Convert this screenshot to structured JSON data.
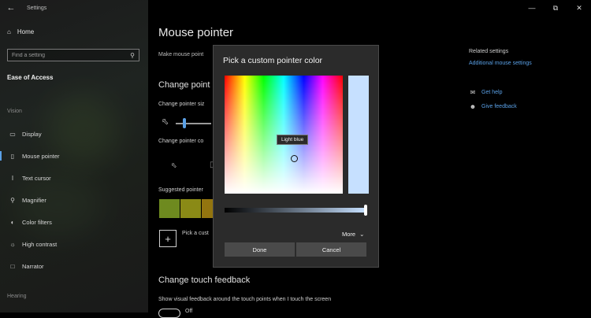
{
  "window": {
    "app_title": "Settings",
    "controls": [
      "minimize-icon",
      "restore-icon",
      "close-icon"
    ]
  },
  "sidebar": {
    "home_label": "Home",
    "search_placeholder": "Find a setting",
    "section_title": "Ease of Access",
    "group_vision": "Vision",
    "group_hearing": "Hearing",
    "items": [
      {
        "label": "Display",
        "icon": "monitor-icon"
      },
      {
        "label": "Mouse pointer",
        "icon": "mouse-icon",
        "active": true
      },
      {
        "label": "Text cursor",
        "icon": "text-cursor-icon"
      },
      {
        "label": "Magnifier",
        "icon": "magnifier-icon"
      },
      {
        "label": "Color filters",
        "icon": "color-filters-icon"
      },
      {
        "label": "High contrast",
        "icon": "high-contrast-icon"
      },
      {
        "label": "Narrator",
        "icon": "narrator-icon"
      }
    ]
  },
  "main": {
    "page_title": "Mouse pointer",
    "desc": "Make mouse point",
    "change_pointer_heading": "Change point",
    "size_label": "Change pointer siz",
    "color_label": "Change pointer co",
    "suggested_label": "Suggested pointer",
    "suggested_colors": [
      "#6e8a1f",
      "#8a8a16",
      "#93750f"
    ],
    "pick_label": "Pick a cust",
    "touch_heading": "Change touch feedback",
    "touch_desc": "Show visual feedback around the touch points when I touch the screen",
    "touch_toggle_label": "Off"
  },
  "related": {
    "title": "Related settings",
    "link": "Additional mouse settings",
    "help": "Get help",
    "feedback": "Give feedback"
  },
  "dialog": {
    "title": "Pick a custom pointer color",
    "tooltip": "Light blue",
    "preview_color": "#c6e0ff",
    "more_label": "More",
    "done_label": "Done",
    "cancel_label": "Cancel"
  }
}
